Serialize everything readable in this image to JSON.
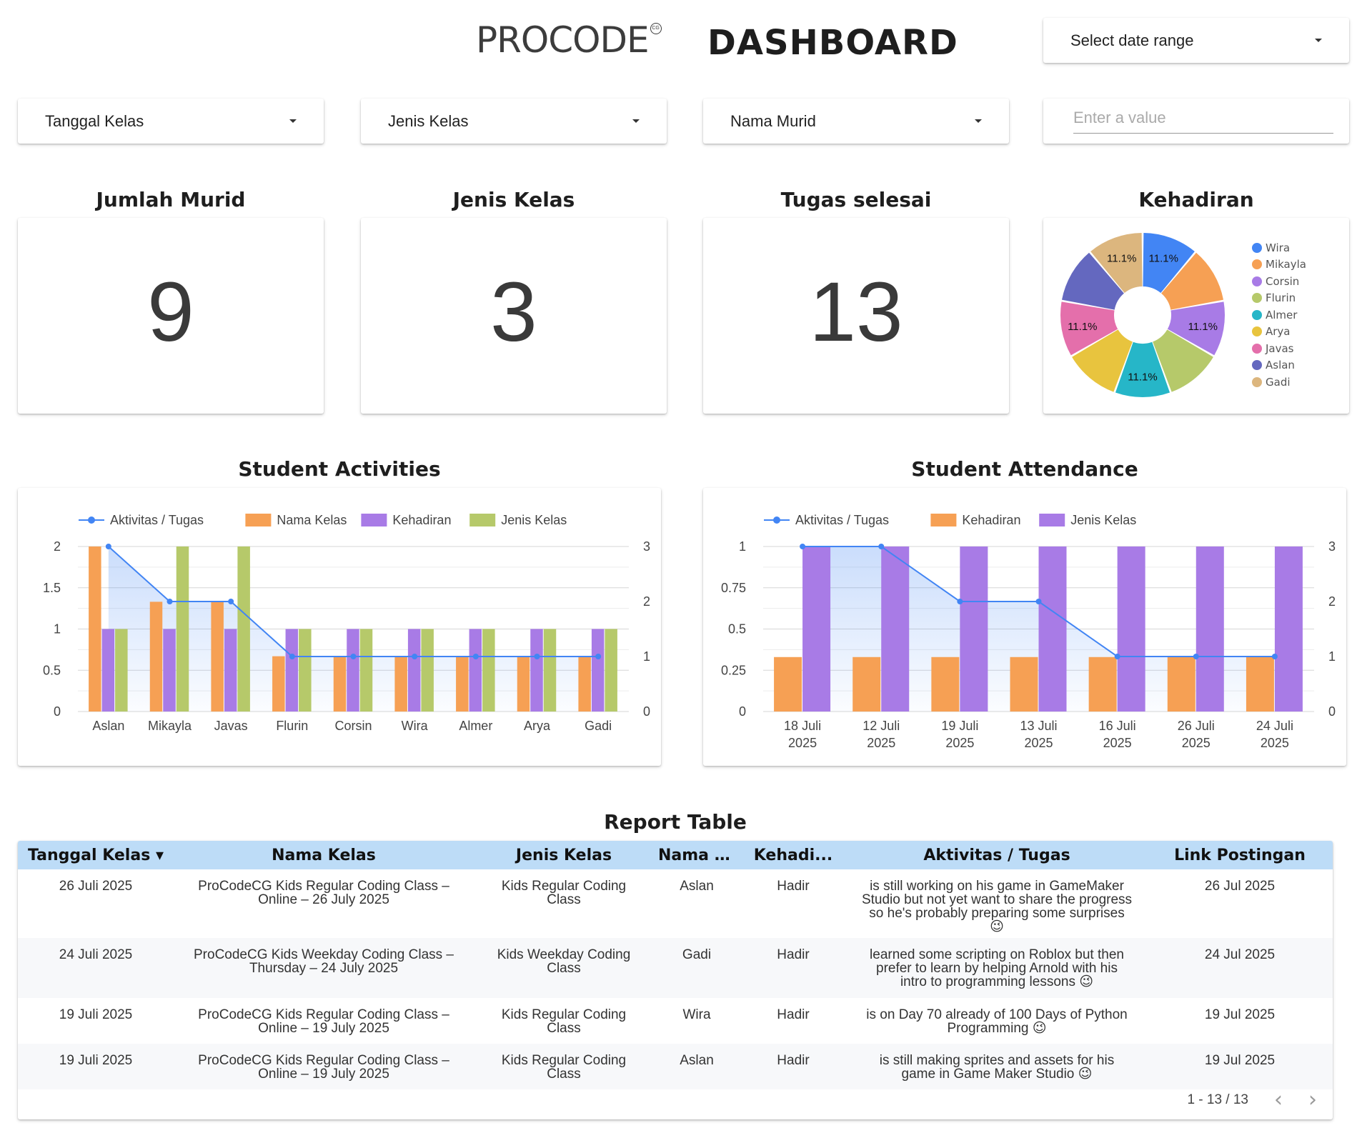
{
  "header": {
    "logo_text": "PROCODE",
    "logo_mark": "CG",
    "title": "DASHBOARD",
    "date_range_label": "Select date range"
  },
  "filters": {
    "tanggal_kelas": "Tanggal Kelas",
    "jenis_kelas": "Jenis Kelas",
    "nama_murid": "Nama Murid",
    "search_placeholder": "Enter a value"
  },
  "kpis": [
    {
      "title": "Jumlah Murid",
      "value": "9"
    },
    {
      "title": "Jenis Kelas",
      "value": "3"
    },
    {
      "title": "Tugas selesai",
      "value": "13"
    }
  ],
  "colors": {
    "blue": "#4285f4",
    "orange": "#f6a054",
    "purple": "#a87be6",
    "green": "#b6c96a",
    "teal": "#26b6c8",
    "yellow": "#e8c43e",
    "pink": "#e46fab",
    "indigo": "#6468bf",
    "tan": "#dcb67e",
    "header_row": "#bddcf7"
  },
  "chart_data": [
    {
      "type": "pie",
      "title": "Kehadiran",
      "categories": [
        "Wira",
        "Mikayla",
        "Corsin",
        "Flurin",
        "Almer",
        "Arya",
        "Javas",
        "Aslan",
        "Gadi"
      ],
      "values": [
        11.1,
        11.1,
        11.1,
        11.1,
        11.1,
        11.1,
        11.1,
        11.1,
        11.1
      ],
      "labels": [
        "11.1%",
        "",
        "11.1%",
        "",
        "11.1%",
        "",
        "11.1%",
        "",
        "11.1%"
      ],
      "legend": "right",
      "donut": true
    },
    {
      "type": "bar",
      "title": "Student Activities",
      "categories": [
        "Aslan",
        "Mikayla",
        "Javas",
        "Flurin",
        "Corsin",
        "Wira",
        "Almer",
        "Arya",
        "Gadi"
      ],
      "series": [
        {
          "name": "Nama Kelas",
          "axis": "left",
          "values": [
            2,
            1.33,
            1.33,
            0.67,
            0.67,
            0.67,
            0.67,
            0.67,
            0.67
          ]
        },
        {
          "name": "Kehadiran",
          "axis": "left",
          "values": [
            1,
            1,
            1,
            1,
            1,
            1,
            1,
            1,
            1
          ]
        },
        {
          "name": "Jenis Kelas",
          "axis": "left",
          "values": [
            1,
            2,
            2,
            1,
            1,
            1,
            1,
            1,
            1
          ]
        },
        {
          "name": "Aktivitas / Tugas",
          "axis": "right",
          "kind": "line",
          "values": [
            3,
            2,
            2,
            1,
            1,
            1,
            1,
            1,
            1
          ]
        }
      ],
      "legend_order": [
        "Aktivitas / Tugas",
        "Nama Kelas",
        "Kehadiran",
        "Jenis Kelas"
      ],
      "y_left": {
        "ticks": [
          "0",
          "0.5",
          "1",
          "1.5",
          "2"
        ],
        "lim": [
          0,
          2
        ]
      },
      "y_right": {
        "ticks": [
          "0",
          "1",
          "2",
          "3"
        ],
        "lim": [
          0,
          3
        ]
      },
      "legend": "top",
      "grid": true
    },
    {
      "type": "bar",
      "title": "Student Attendance",
      "categories": [
        "18 Juli|2025",
        "12 Juli|2025",
        "19 Juli|2025",
        "13 Juli|2025",
        "16 Juli|2025",
        "26 Juli|2025",
        "24 Juli|2025"
      ],
      "series": [
        {
          "name": "Kehadiran",
          "axis": "left",
          "values": [
            0.33,
            0.33,
            0.33,
            0.33,
            0.33,
            0.33,
            0.33
          ]
        },
        {
          "name": "Jenis Kelas",
          "axis": "right",
          "values": [
            3,
            3,
            3,
            3,
            3,
            3,
            3
          ]
        },
        {
          "name": "Aktivitas / Tugas",
          "axis": "right",
          "kind": "line",
          "values": [
            3,
            3,
            2,
            2,
            1,
            1,
            1
          ]
        }
      ],
      "legend_order": [
        "Aktivitas / Tugas",
        "Kehadiran",
        "Jenis Kelas"
      ],
      "y_left": {
        "ticks": [
          "0",
          "0.25",
          "0.5",
          "0.75",
          "1"
        ],
        "lim": [
          0,
          1
        ]
      },
      "y_right": {
        "ticks": [
          "0",
          "1",
          "2",
          "3"
        ],
        "lim": [
          0,
          3
        ]
      },
      "legend": "top",
      "grid": true
    }
  ],
  "report": {
    "title": "Report Table",
    "sort_indicator": "▾",
    "columns": [
      "Tanggal Kelas",
      "Nama Kelas",
      "Jenis Kelas",
      "Nama M...",
      "Kehadi...",
      "Aktivitas / Tugas",
      "Link Postingan"
    ],
    "rows": [
      [
        "26 Juli 2025",
        "ProCodeCG Kids Regular Coding Class – Online – 26 July 2025",
        "Kids Regular Coding Class",
        "Aslan",
        "Hadir",
        "is still working on his game in GameMaker Studio but not yet want to share the progress so he's probably preparing some surprises 😉",
        "26 Jul 2025"
      ],
      [
        "24 Juli 2025",
        "ProCodeCG Kids Weekday Coding Class – Thursday – 24 July 2025",
        "Kids Weekday Coding Class",
        "Gadi",
        "Hadir",
        "learned some scripting on Roblox but then prefer to learn by helping Arnold with his intro to programming lessons 😉",
        "24 Jul 2025"
      ],
      [
        "19 Juli 2025",
        "ProCodeCG Kids Regular Coding Class – Online – 19 July 2025",
        "Kids Regular Coding Class",
        "Wira",
        "Hadir",
        "is on Day 70 already of 100 Days of Python Programming 😉",
        "19 Jul 2025"
      ],
      [
        "19 Juli 2025",
        "ProCodeCG Kids Regular Coding Class – Online – 19 July 2025",
        "Kids Regular Coding Class",
        "Aslan",
        "Hadir",
        "is still making sprites and assets for his game in Game Maker Studio 😉",
        "19 Jul 2025"
      ]
    ],
    "pagination": "1 - 13 / 13",
    "prev_icon": "‹",
    "next_icon": "›"
  }
}
